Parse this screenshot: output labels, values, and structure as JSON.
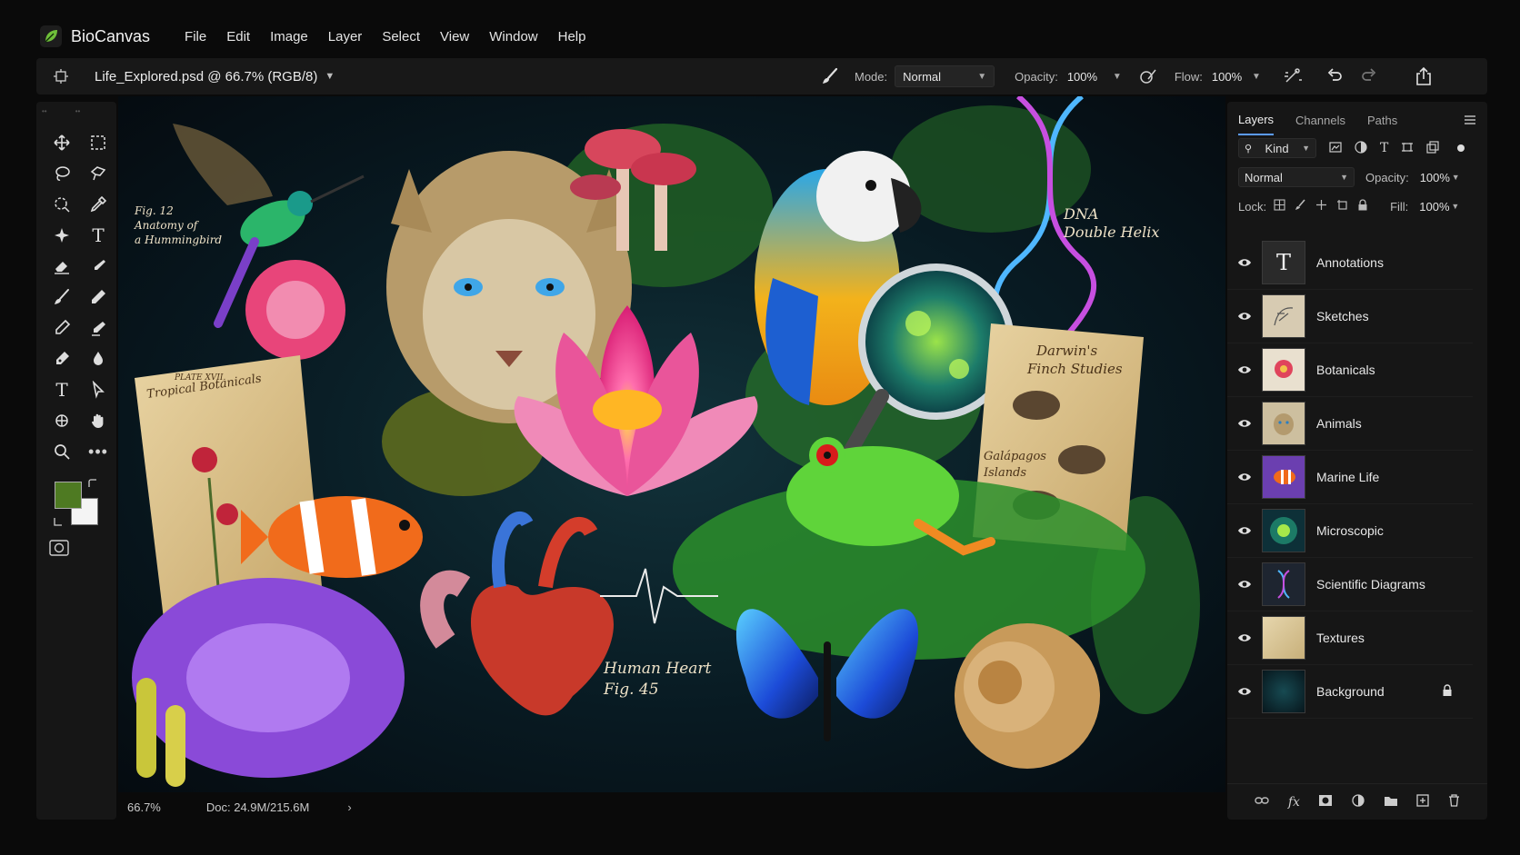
{
  "app": {
    "name": "BioCanvas",
    "menu": [
      "File",
      "Edit",
      "Image",
      "Layer",
      "Select",
      "View",
      "Window",
      "Help"
    ]
  },
  "document": {
    "title": "Life_Explored.psd @ 66.7% (RGB/8)"
  },
  "options": {
    "mode_label": "Mode:",
    "mode_value": "Normal",
    "opacity_label": "Opacity:",
    "opacity_value": "100%",
    "flow_label": "Flow:",
    "flow_value": "100%"
  },
  "colors": {
    "foreground": "#4e7a22",
    "background": "#f4f4f4",
    "accent": "#5c9bff"
  },
  "canvas": {
    "annotations": {
      "hummingbird": "Fig. 12\nAnatomy of\na Hummingbird",
      "botanicals": "Tropical Botanicals",
      "plate": "PLATE XVII.",
      "dna": "DNA\nDouble Helix",
      "darwin": "Darwin's\nFinch Studies",
      "galapagos": "Galápagos\nIslands",
      "heart": "Human Heart\nFig. 45"
    }
  },
  "status": {
    "zoom": "66.7%",
    "doc": "Doc: 24.9M/215.6M"
  },
  "panel": {
    "tabs": [
      "Layers",
      "Channels",
      "Paths"
    ],
    "filter_kind": "Kind",
    "blend_mode": "Normal",
    "opacity_label": "Opacity:",
    "opacity_value": "100%",
    "lock_label": "Lock:",
    "fill_label": "Fill:",
    "fill_value": "100%",
    "layers": [
      {
        "name": "Annotations",
        "thumb": "text"
      },
      {
        "name": "Sketches",
        "thumb": "sketch"
      },
      {
        "name": "Botanicals",
        "thumb": "flower"
      },
      {
        "name": "Animals",
        "thumb": "leopard"
      },
      {
        "name": "Marine Life",
        "thumb": "clownfish"
      },
      {
        "name": "Microscopic",
        "thumb": "cell"
      },
      {
        "name": "Scientific Diagrams",
        "thumb": "dna"
      },
      {
        "name": "Textures",
        "thumb": "paper"
      },
      {
        "name": "Background",
        "thumb": "dark",
        "locked": true
      }
    ]
  }
}
